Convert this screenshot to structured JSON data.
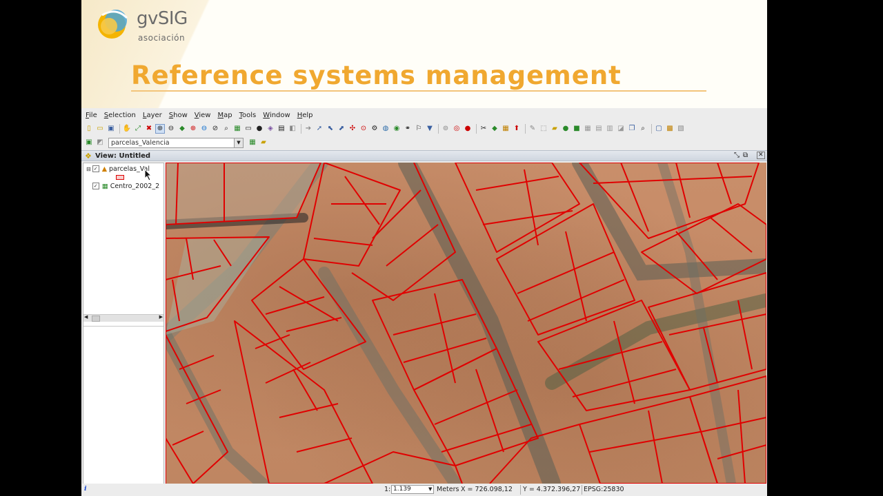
{
  "slide": {
    "logo_name": "gvSIG",
    "logo_sub": "asociación",
    "title": "Reference systems management"
  },
  "app": {
    "menu": [
      "File",
      "Selection",
      "Layer",
      "Show",
      "View",
      "Map",
      "Tools",
      "Window",
      "Help"
    ],
    "active_layer": "parcelas_Valencia",
    "view_title": "View: Untitled",
    "toc": {
      "layers": [
        {
          "name": "parcelas_Val",
          "visible": true,
          "type": "vector"
        },
        {
          "name": "Centro_2002_2",
          "visible": true,
          "type": "raster"
        }
      ]
    },
    "map": {
      "parcel_color": "#e00000",
      "imagery": "orthophoto"
    },
    "status": {
      "scale_prefix": "1:",
      "scale_value": "1.139",
      "units": "Meters",
      "x": "X = 726.098,12",
      "y": "Y = 4.372.396,27",
      "crs": "EPSG:25830",
      "info_icon": "i"
    }
  },
  "colors": {
    "title": "#f0a830",
    "logo_gray": "#6b6b6b",
    "parcel": "#e00000"
  }
}
